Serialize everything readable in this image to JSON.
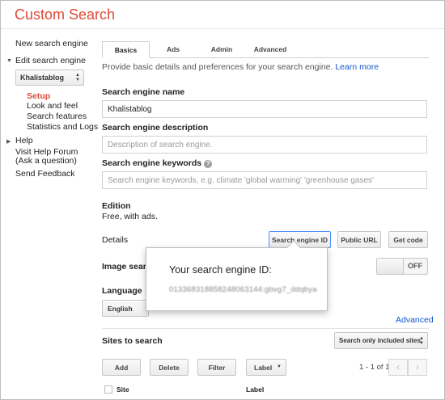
{
  "app": {
    "title": "Custom Search"
  },
  "sidebar": {
    "new_engine": "New search engine",
    "edit_engine": "Edit search engine",
    "selected_engine": "Khalistablog",
    "sub_items": [
      "Setup",
      "Look and feel",
      "Search features",
      "Statistics and Logs"
    ],
    "help": "Help",
    "forum_line1": "Visit Help Forum",
    "forum_line2": "(Ask a question)",
    "feedback": "Send Feedback"
  },
  "tabs": [
    "Basics",
    "Ads",
    "Admin",
    "Advanced"
  ],
  "intro": {
    "text": "Provide basic details and preferences for your search engine.",
    "link": "Learn more"
  },
  "name": {
    "label": "Search engine name",
    "value": "Khalistablog"
  },
  "description": {
    "label": "Search engine description",
    "placeholder": "Description of search engine."
  },
  "keywords": {
    "label": "Search engine keywords",
    "placeholder": "Search engine keywords, e.g. climate 'global warming' 'greenhouse gases'"
  },
  "edition": {
    "label": "Edition",
    "value": "Free, with ads."
  },
  "details": {
    "label": "Details",
    "buttons": [
      "Search engine ID",
      "Public URL",
      "Get code"
    ]
  },
  "image_search": {
    "label": "Image search",
    "toggle": "OFF"
  },
  "language": {
    "label": "Language",
    "value": "English"
  },
  "advanced_link": "Advanced",
  "sites": {
    "label": "Sites to search",
    "filter_select": "Search only included sites",
    "actions": [
      "Add",
      "Delete",
      "Filter",
      "Label"
    ],
    "pager": "1 - 1 of 1",
    "columns": [
      "Site",
      "Label"
    ]
  },
  "popup": {
    "title": "Your search engine ID:",
    "id_value": "013368318858248063144:gbvg7_ddqbya"
  },
  "colors": {
    "brand": "#dd4b39",
    "link": "#1155cc",
    "focus": "#4d90fe"
  }
}
